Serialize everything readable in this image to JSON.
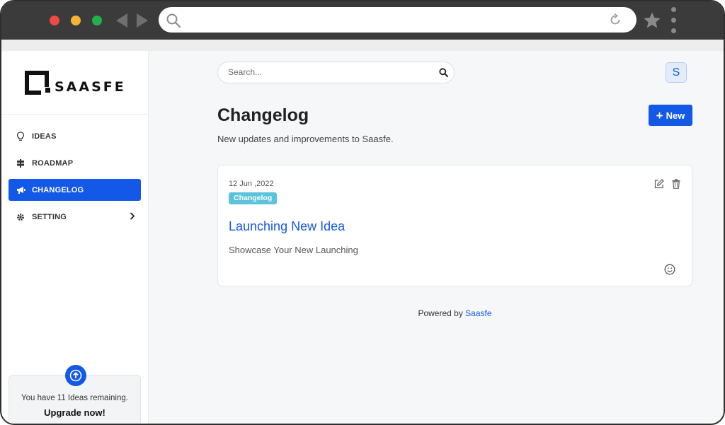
{
  "browser": {
    "icons": [
      "search-icon",
      "reload-icon",
      "star-icon",
      "more-icon",
      "back-icon",
      "forward-icon"
    ]
  },
  "sidebar": {
    "logo_text": "SAASFE",
    "items": [
      {
        "label": "IDEAS",
        "icon": "lightbulb-icon",
        "active": false
      },
      {
        "label": "ROADMAP",
        "icon": "signpost-icon",
        "active": false
      },
      {
        "label": "CHANGELOG",
        "icon": "megaphone-icon",
        "active": true
      },
      {
        "label": "SETTING",
        "icon": "gear-icon",
        "active": false
      }
    ],
    "upgrade": {
      "message": "You have 11 Ideas remaining.",
      "link": "Upgrade now!"
    }
  },
  "header": {
    "search_placeholder": "Search...",
    "avatar_initial": "S"
  },
  "main": {
    "title": "Changelog",
    "subtitle": "New updates and improvements to Saasfe.",
    "new_button": "New"
  },
  "entry": {
    "date": "12 Jun ,2022",
    "badge": "Changelog",
    "title": "Launching New Idea",
    "description": "Showcase Your New Launching"
  },
  "footer": {
    "prefix": "Powered by",
    "brand": "Saasfe"
  },
  "colors": {
    "primary": "#1458e8",
    "badge": "#5bc3dc",
    "chrome": "#3b3b3b",
    "background": "#f6f7f9"
  }
}
